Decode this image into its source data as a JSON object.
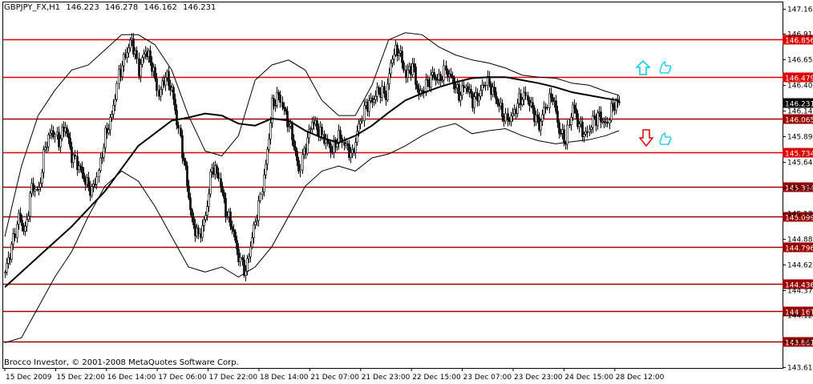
{
  "header": {
    "symbol": "GBPJPY_FX,H1",
    "open": "146.223",
    "high": "146.278",
    "low": "146.162",
    "close": "146.231"
  },
  "footer": {
    "copyright": "Brocco Investor, © 2001-2008 MetaQuotes Software Corp."
  },
  "signals": {
    "buy_arrow": "up-arrow-icon",
    "sell_arrow": "down-arrow-icon",
    "buy_color": "#00c8e8",
    "sell_color": "#e00000",
    "thumb_color": "#00c8e8"
  },
  "chart_data": {
    "type": "candlestick",
    "symbol": "GBPJPY_FX",
    "timeframe": "H1",
    "ylim": [
      143.6,
      147.22
    ],
    "y_ticks": [
      {
        "value": 147.16,
        "label": "147.160"
      },
      {
        "value": 146.91,
        "label": "146.910"
      },
      {
        "value": 146.655,
        "label": "146.655"
      },
      {
        "value": 146.4,
        "label": "146.400"
      },
      {
        "value": 146.145,
        "label": "146.145"
      },
      {
        "value": 145.895,
        "label": "145.895"
      },
      {
        "value": 145.64,
        "label": "145.640"
      },
      {
        "value": 145.385,
        "label": "145.385"
      },
      {
        "value": 145.13,
        "label": "145.130"
      },
      {
        "value": 144.88,
        "label": "144.880"
      },
      {
        "value": 144.625,
        "label": "144.625"
      },
      {
        "value": 144.37,
        "label": "144.370"
      },
      {
        "value": 144.12,
        "label": "144.120"
      },
      {
        "value": 143.865,
        "label": "143.865"
      },
      {
        "value": 143.61,
        "label": "143.610"
      }
    ],
    "x_labels": [
      "15 Dec 2009",
      "15 Dec 22:00",
      "16 Dec 14:00",
      "17 Dec 06:00",
      "17 Dec 22:00",
      "18 Dec 14:00",
      "21 Dec 07:00",
      "21 Dec 23:00",
      "22 Dec 15:00",
      "23 Dec 07:00",
      "23 Dec 23:00",
      "24 Dec 15:00",
      "28 Dec 12:00"
    ],
    "levels": [
      {
        "value": 146.856,
        "label": "146.856",
        "color": "#dd0000"
      },
      {
        "value": 146.479,
        "label": "146.479",
        "color": "#dd0000"
      },
      {
        "value": 146.065,
        "label": "146.065",
        "color": "#990000"
      },
      {
        "value": 145.734,
        "label": "145.734",
        "color": "#dd0000"
      },
      {
        "value": 145.394,
        "label": "145.394",
        "color": "#990000"
      },
      {
        "value": 145.099,
        "label": "145.099",
        "color": "#990000"
      },
      {
        "value": 144.796,
        "label": "144.796",
        "color": "#990000"
      },
      {
        "value": 144.436,
        "label": "144.436",
        "color": "#990000"
      },
      {
        "value": 144.161,
        "label": "144.161",
        "color": "#990000"
      },
      {
        "value": 143.861,
        "label": "143.861",
        "color": "#990000"
      }
    ],
    "current_price": {
      "value": 146.231,
      "label": "146.231"
    },
    "close_path": [
      [
        0,
        144.55
      ],
      [
        4,
        144.8
      ],
      [
        8,
        145.1
      ],
      [
        12,
        144.95
      ],
      [
        16,
        145.4
      ],
      [
        20,
        145.35
      ],
      [
        24,
        145.8
      ],
      [
        28,
        145.95
      ],
      [
        32,
        145.85
      ],
      [
        36,
        146.0
      ],
      [
        40,
        145.7
      ],
      [
        44,
        145.6
      ],
      [
        48,
        145.45
      ],
      [
        52,
        145.35
      ],
      [
        56,
        145.55
      ],
      [
        60,
        145.9
      ],
      [
        64,
        146.1
      ],
      [
        68,
        146.5
      ],
      [
        72,
        146.7
      ],
      [
        76,
        146.85
      ],
      [
        80,
        146.55
      ],
      [
        84,
        146.75
      ],
      [
        88,
        146.6
      ],
      [
        92,
        146.3
      ],
      [
        96,
        146.5
      ],
      [
        100,
        146.35
      ],
      [
        104,
        145.95
      ],
      [
        108,
        145.55
      ],
      [
        112,
        145.05
      ],
      [
        116,
        144.9
      ],
      [
        120,
        145.1
      ],
      [
        124,
        145.6
      ],
      [
        128,
        145.5
      ],
      [
        132,
        145.15
      ],
      [
        136,
        145.0
      ],
      [
        140,
        144.7
      ],
      [
        144,
        144.55
      ],
      [
        148,
        144.9
      ],
      [
        152,
        145.2
      ],
      [
        156,
        145.6
      ],
      [
        160,
        146.2
      ],
      [
        164,
        146.3
      ],
      [
        168,
        146.1
      ],
      [
        172,
        145.9
      ],
      [
        176,
        145.55
      ],
      [
        180,
        145.8
      ],
      [
        184,
        146.05
      ],
      [
        188,
        145.95
      ],
      [
        192,
        145.85
      ],
      [
        196,
        145.75
      ],
      [
        200,
        145.9
      ],
      [
        204,
        145.8
      ],
      [
        208,
        145.7
      ],
      [
        212,
        146.0
      ],
      [
        216,
        146.2
      ],
      [
        220,
        146.25
      ],
      [
        224,
        146.35
      ],
      [
        228,
        146.3
      ],
      [
        232,
        146.7
      ],
      [
        236,
        146.75
      ],
      [
        240,
        146.5
      ],
      [
        244,
        146.6
      ],
      [
        248,
        146.3
      ],
      [
        252,
        146.4
      ],
      [
        256,
        146.5
      ],
      [
        260,
        146.45
      ],
      [
        264,
        146.55
      ],
      [
        268,
        146.45
      ],
      [
        272,
        146.3
      ],
      [
        276,
        146.4
      ],
      [
        280,
        146.25
      ],
      [
        284,
        146.3
      ],
      [
        288,
        146.45
      ],
      [
        292,
        146.35
      ],
      [
        296,
        146.2
      ],
      [
        300,
        146.05
      ],
      [
        304,
        146.1
      ],
      [
        308,
        146.25
      ],
      [
        312,
        146.3
      ],
      [
        316,
        146.15
      ],
      [
        320,
        146.0
      ],
      [
        324,
        146.2
      ],
      [
        328,
        146.3
      ],
      [
        332,
        145.95
      ],
      [
        336,
        145.85
      ],
      [
        340,
        146.2
      ],
      [
        344,
        146.0
      ],
      [
        348,
        145.9
      ],
      [
        352,
        146.05
      ],
      [
        356,
        146.1
      ],
      [
        360,
        146.0
      ],
      [
        364,
        146.2
      ],
      [
        368,
        146.23
      ]
    ],
    "ma_path": [
      [
        0,
        144.4
      ],
      [
        20,
        144.7
      ],
      [
        40,
        145.0
      ],
      [
        60,
        145.35
      ],
      [
        80,
        145.8
      ],
      [
        100,
        146.05
      ],
      [
        110,
        146.08
      ],
      [
        120,
        146.12
      ],
      [
        130,
        146.1
      ],
      [
        140,
        146.02
      ],
      [
        150,
        146.0
      ],
      [
        160,
        146.07
      ],
      [
        170,
        146.05
      ],
      [
        180,
        145.95
      ],
      [
        190,
        145.88
      ],
      [
        200,
        145.83
      ],
      [
        210,
        145.9
      ],
      [
        220,
        146.0
      ],
      [
        230,
        146.13
      ],
      [
        240,
        146.25
      ],
      [
        250,
        146.32
      ],
      [
        260,
        146.38
      ],
      [
        270,
        146.43
      ],
      [
        280,
        146.47
      ],
      [
        290,
        146.48
      ],
      [
        300,
        146.48
      ],
      [
        310,
        146.45
      ],
      [
        320,
        146.42
      ],
      [
        330,
        146.38
      ],
      [
        340,
        146.33
      ],
      [
        350,
        146.3
      ],
      [
        360,
        146.27
      ],
      [
        368,
        146.25
      ]
    ],
    "upper_band": [
      [
        0,
        144.9
      ],
      [
        10,
        145.6
      ],
      [
        20,
        146.1
      ],
      [
        30,
        146.35
      ],
      [
        40,
        146.55
      ],
      [
        50,
        146.6
      ],
      [
        60,
        146.75
      ],
      [
        70,
        146.9
      ],
      [
        80,
        146.9
      ],
      [
        90,
        146.8
      ],
      [
        100,
        146.55
      ],
      [
        110,
        146.1
      ],
      [
        120,
        145.75
      ],
      [
        130,
        145.7
      ],
      [
        140,
        145.9
      ],
      [
        150,
        146.45
      ],
      [
        160,
        146.6
      ],
      [
        170,
        146.65
      ],
      [
        180,
        146.55
      ],
      [
        190,
        146.25
      ],
      [
        200,
        146.1
      ],
      [
        210,
        146.1
      ],
      [
        220,
        146.4
      ],
      [
        230,
        146.85
      ],
      [
        240,
        146.92
      ],
      [
        250,
        146.9
      ],
      [
        260,
        146.78
      ],
      [
        270,
        146.7
      ],
      [
        280,
        146.65
      ],
      [
        290,
        146.62
      ],
      [
        300,
        146.57
      ],
      [
        310,
        146.5
      ],
      [
        320,
        146.48
      ],
      [
        330,
        146.47
      ],
      [
        340,
        146.42
      ],
      [
        350,
        146.4
      ],
      [
        360,
        146.34
      ],
      [
        368,
        146.3
      ]
    ],
    "lower_band": [
      [
        0,
        143.85
      ],
      [
        10,
        143.9
      ],
      [
        20,
        144.2
      ],
      [
        30,
        144.5
      ],
      [
        40,
        144.75
      ],
      [
        50,
        145.1
      ],
      [
        60,
        145.4
      ],
      [
        70,
        145.55
      ],
      [
        80,
        145.45
      ],
      [
        90,
        145.2
      ],
      [
        100,
        144.9
      ],
      [
        110,
        144.6
      ],
      [
        120,
        144.55
      ],
      [
        130,
        144.6
      ],
      [
        140,
        144.5
      ],
      [
        150,
        144.6
      ],
      [
        160,
        144.8
      ],
      [
        170,
        145.1
      ],
      [
        180,
        145.4
      ],
      [
        190,
        145.55
      ],
      [
        200,
        145.6
      ],
      [
        210,
        145.55
      ],
      [
        220,
        145.68
      ],
      [
        230,
        145.72
      ],
      [
        240,
        145.8
      ],
      [
        250,
        145.9
      ],
      [
        260,
        145.98
      ],
      [
        270,
        146.02
      ],
      [
        280,
        145.92
      ],
      [
        290,
        145.95
      ],
      [
        300,
        145.97
      ],
      [
        310,
        145.9
      ],
      [
        320,
        145.85
      ],
      [
        330,
        145.82
      ],
      [
        340,
        145.84
      ],
      [
        350,
        145.86
      ],
      [
        360,
        145.9
      ],
      [
        368,
        145.95
      ]
    ]
  }
}
